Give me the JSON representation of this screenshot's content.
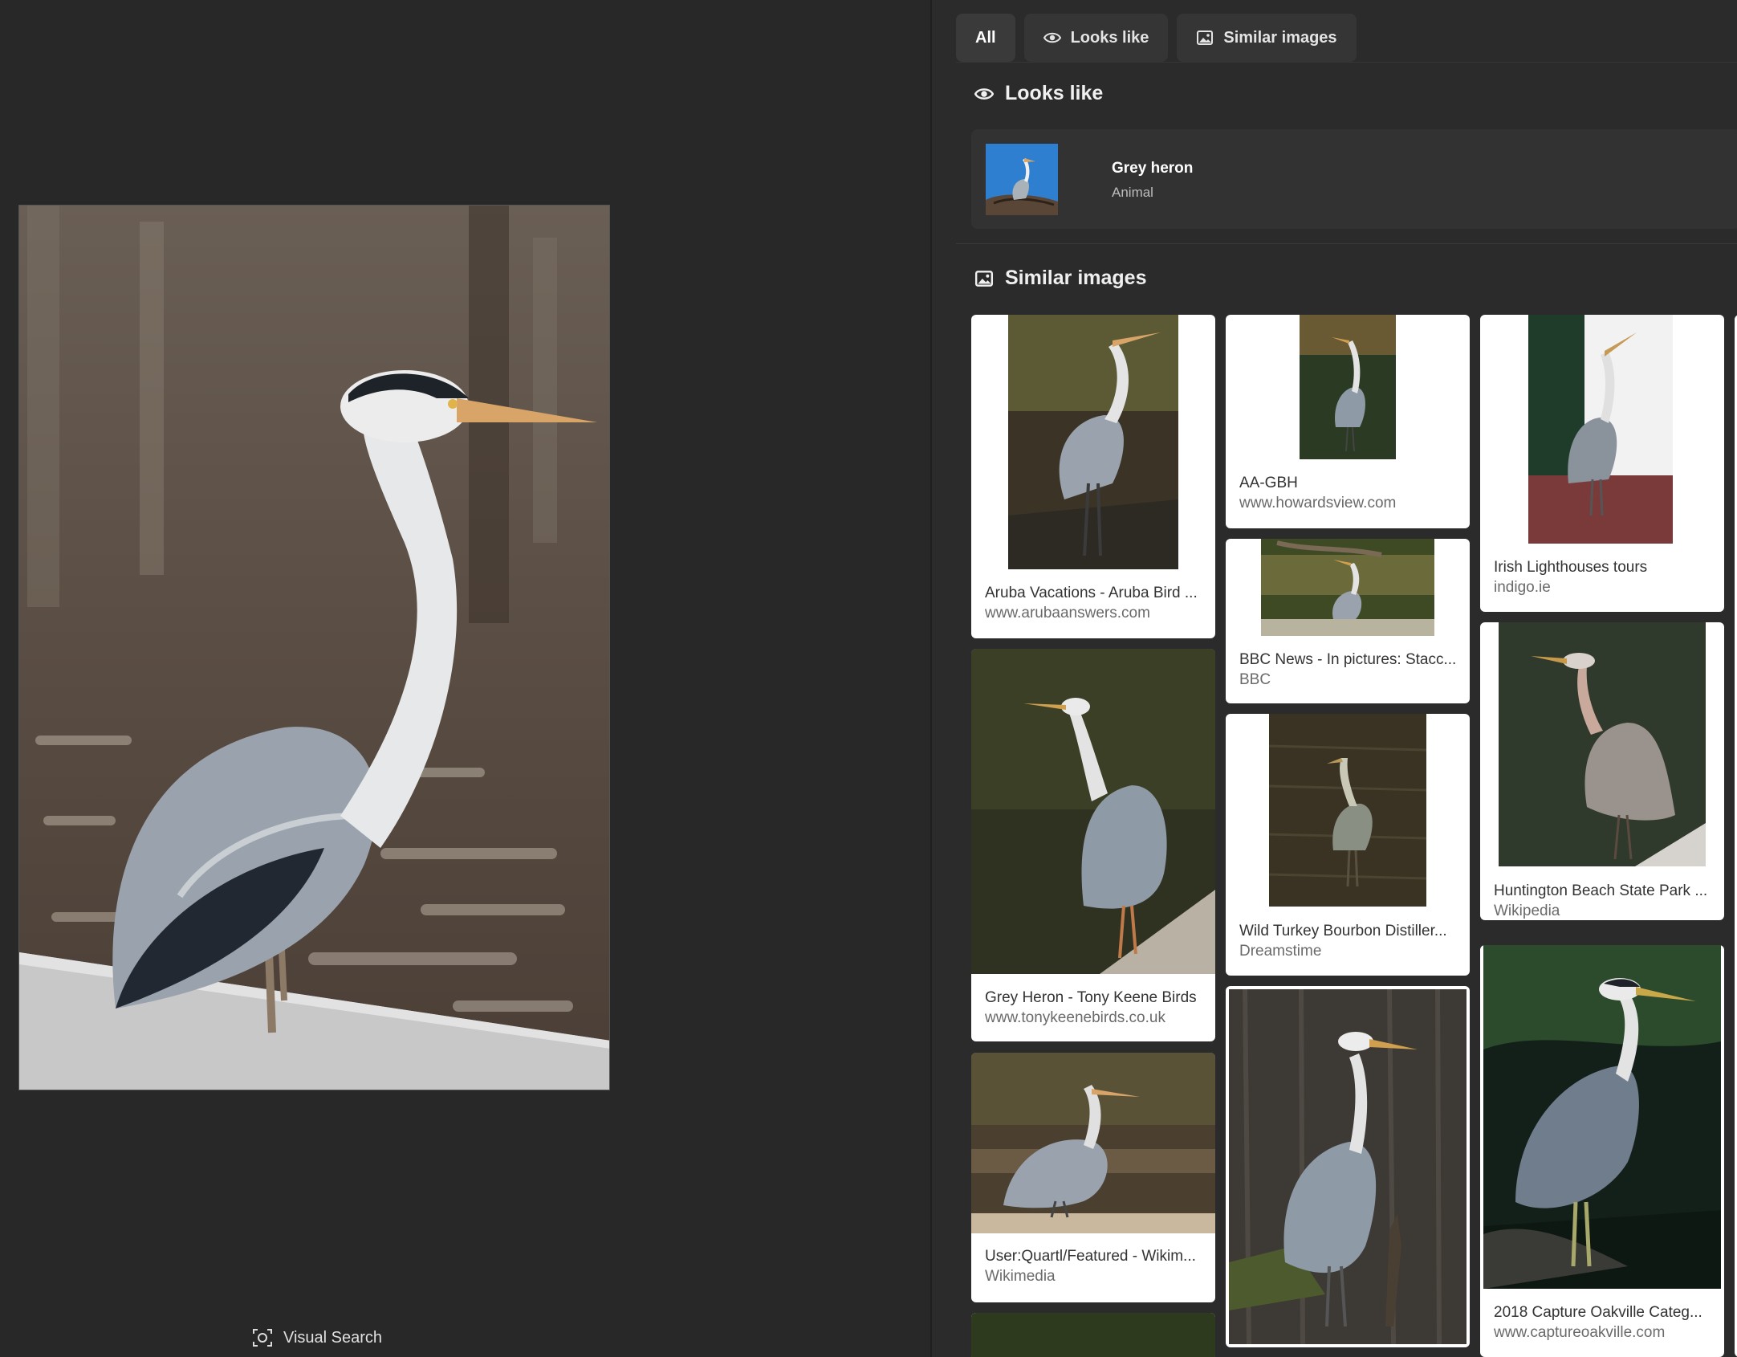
{
  "viewer": {
    "visual_search_label": "Visual Search"
  },
  "tabs": [
    {
      "label": "All",
      "icon": "none"
    },
    {
      "label": "Looks like",
      "icon": "eye-icon"
    },
    {
      "label": "Similar images",
      "icon": "image-icon"
    }
  ],
  "looks_like": {
    "heading": "Looks like",
    "result": {
      "title": "Grey heron",
      "subtitle": "Animal"
    }
  },
  "similar_images": {
    "heading": "Similar images",
    "items": [
      {
        "title": "Aruba Vacations - Aruba Bird ...",
        "source": "www.arubaanswers.com"
      },
      {
        "title": "Grey Heron - Tony Keene Birds",
        "source": "www.tonykeenebirds.co.uk"
      },
      {
        "title": "User:Quartl/Featured - Wikim...",
        "source": "Wikimedia"
      },
      {
        "title": "AA-GBH",
        "source": "www.howardsview.com"
      },
      {
        "title": "BBC News - In pictures: Stacc...",
        "source": "BBC"
      },
      {
        "title": "Wild Turkey Bourbon Distiller...",
        "source": "Dreamstime"
      },
      {
        "title": "Irish Lighthouses tours",
        "source": "indigo.ie"
      },
      {
        "title": "Huntington Beach State Park ...",
        "source": "Wikipedia"
      },
      {
        "title": "2018 Capture Oakville Categ...",
        "source": "www.captureoakville.com"
      }
    ]
  },
  "colors": {
    "background": "#282828",
    "panel": "#2b2b2b",
    "card": "#ffffff",
    "heron_grey": "#9aa3ad"
  }
}
